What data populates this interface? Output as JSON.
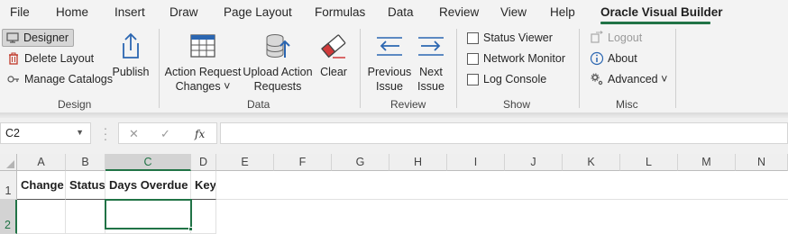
{
  "tabs": [
    "File",
    "Home",
    "Insert",
    "Draw",
    "Page Layout",
    "Formulas",
    "Data",
    "Review",
    "View",
    "Help",
    "Oracle Visual Builder"
  ],
  "active_tab_index": 10,
  "ribbon": {
    "design": {
      "label": "Design",
      "designer": "Designer",
      "delete_layout": "Delete Layout",
      "manage_catalogs": "Manage Catalogs",
      "publish": "Publish"
    },
    "data": {
      "label": "Data",
      "action_request_changes_line1": "Action Request",
      "action_request_changes_line2": "Changes ˅",
      "upload_action_requests_line1": "Upload Action",
      "upload_action_requests_line2": "Requests",
      "clear": "Clear"
    },
    "review": {
      "label": "Review",
      "previous_issue_line1": "Previous",
      "previous_issue_line2": "Issue",
      "next_issue_line1": "Next",
      "next_issue_line2": "Issue"
    },
    "show": {
      "label": "Show",
      "status_viewer": "Status Viewer",
      "network_monitor": "Network Monitor",
      "log_console": "Log Console"
    },
    "misc": {
      "label": "Misc",
      "logout": "Logout",
      "about": "About",
      "advanced": "Advanced ˅"
    }
  },
  "formula_bar": {
    "name_box": "C2",
    "fx": "fx",
    "formula": ""
  },
  "grid": {
    "columns": [
      "A",
      "B",
      "C",
      "D",
      "E",
      "F",
      "G",
      "H",
      "I",
      "J",
      "K",
      "L",
      "M",
      "N"
    ],
    "rows": [
      "1",
      "2"
    ],
    "row1": [
      "Change",
      "Status",
      "Days Overdue",
      "Key"
    ],
    "active_cell": "C2"
  },
  "colors": {
    "accent": "#217346",
    "ribbon_bg": "#f3f3f3",
    "delete_icon": "#c0392b",
    "icon_blue": "#2b66b1"
  }
}
